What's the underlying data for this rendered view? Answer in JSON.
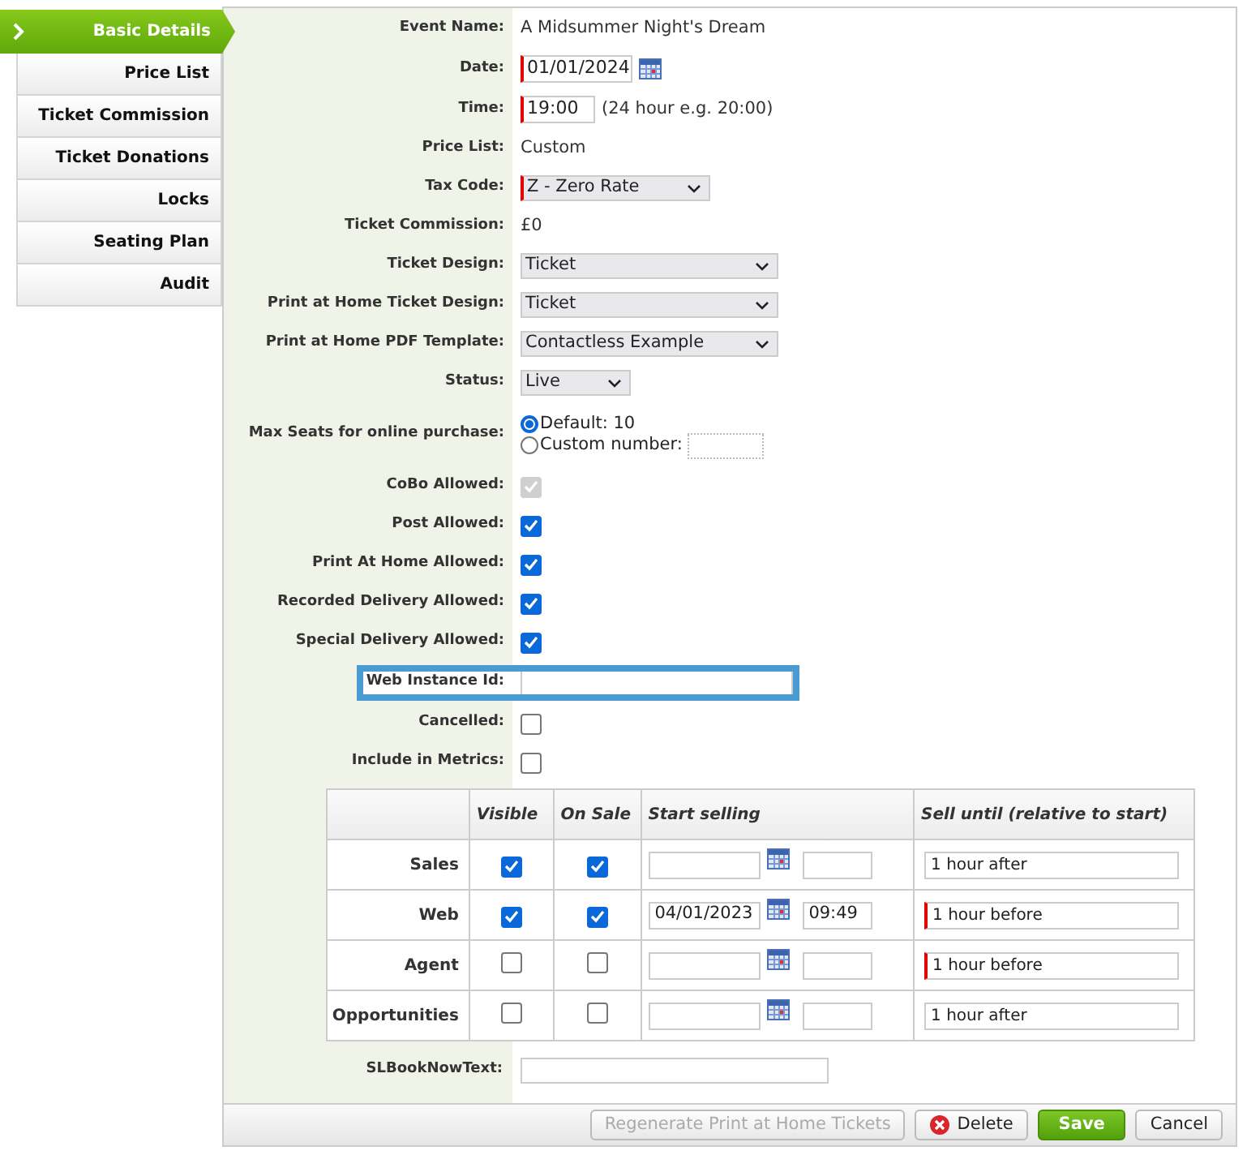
{
  "sidebar": {
    "items": [
      {
        "label": "Basic Details",
        "selected": true
      },
      {
        "label": "Price List",
        "selected": false
      },
      {
        "label": "Ticket Commission",
        "selected": false
      },
      {
        "label": "Ticket Donations",
        "selected": false
      },
      {
        "label": "Locks",
        "selected": false
      },
      {
        "label": "Seating Plan",
        "selected": false
      },
      {
        "label": "Audit",
        "selected": false
      }
    ]
  },
  "fields": [
    {
      "label": "Event Name:",
      "kind": "text",
      "value": "A Midsummer Night's Dream",
      "required": false,
      "highlighted": false
    },
    {
      "label": "Date:",
      "kind": "date",
      "value": "01/01/2024",
      "required": true,
      "highlighted": false
    },
    {
      "label": "Time:",
      "kind": "time",
      "value": "19:00",
      "hint": "(24 hour e.g. 20:00)",
      "required": true,
      "highlighted": false
    },
    {
      "label": "Price List:",
      "kind": "text",
      "value": "Custom",
      "required": false,
      "highlighted": false
    },
    {
      "label": "Tax Code:",
      "kind": "picker",
      "value": "Z - Zero Rate",
      "required": true,
      "highlighted": false
    },
    {
      "label": "Ticket Commission:",
      "kind": "text",
      "value": "£0",
      "required": false,
      "highlighted": false
    },
    {
      "label": "Ticket Design:",
      "kind": "select",
      "value": "Ticket",
      "required": false,
      "highlighted": false
    },
    {
      "label": "Print at Home Ticket Design:",
      "kind": "select",
      "value": "Ticket",
      "required": false,
      "highlighted": false
    },
    {
      "label": "Print at Home PDF Template:",
      "kind": "select",
      "value": "Contactless Example",
      "required": false,
      "highlighted": false
    },
    {
      "label": "Status:",
      "kind": "picker",
      "value": "Live",
      "required": false,
      "highlighted": false
    },
    {
      "label": "Max Seats for online purchase:",
      "kind": "radio",
      "options": [
        {
          "label": "Default: 10",
          "selected": true,
          "kind": "plain"
        },
        {
          "label": "Custom number:",
          "selected": false,
          "kind": "with_input"
        }
      ],
      "required": false,
      "highlighted": false
    },
    {
      "label": "CoBo Allowed:",
      "kind": "checkbox",
      "checked": true,
      "disabled": true,
      "required": false,
      "highlighted": false
    },
    {
      "label": "Post Allowed:",
      "kind": "checkbox",
      "checked": true,
      "disabled": false,
      "required": false,
      "highlighted": false
    },
    {
      "label": "Print At Home Allowed:",
      "kind": "checkbox",
      "checked": true,
      "disabled": false,
      "required": false,
      "highlighted": false
    },
    {
      "label": "Recorded Delivery Allowed:",
      "kind": "checkbox",
      "checked": true,
      "disabled": false,
      "required": false,
      "highlighted": false
    },
    {
      "label": "Special Delivery Allowed:",
      "kind": "checkbox",
      "checked": true,
      "disabled": false,
      "required": false,
      "highlighted": false
    },
    {
      "label": "Web Instance Id:",
      "kind": "input",
      "required": false,
      "highlighted": true
    },
    {
      "label": "Cancelled:",
      "kind": "checkbox",
      "checked": false,
      "disabled": false,
      "required": false,
      "highlighted": false
    },
    {
      "label": "Include in Metrics:",
      "kind": "checkbox",
      "checked": false,
      "disabled": false,
      "required": false,
      "highlighted": false
    }
  ],
  "sales_table": {
    "columns": [
      "Visible",
      "On Sale",
      "Start selling",
      "Sell until (relative to start)"
    ],
    "rows": [
      {
        "channel": "Sales",
        "visible": true,
        "on_sale": true,
        "sell_until": "1 hour after",
        "sell_until_required": false
      },
      {
        "channel": "Web",
        "visible": true,
        "on_sale": true,
        "start_date": "04/01/2023",
        "start_time": "09:49",
        "sell_until": "1 hour before",
        "sell_until_required": true
      },
      {
        "channel": "Agent",
        "visible": false,
        "on_sale": false,
        "sell_until": "1 hour before",
        "sell_until_required": true
      },
      {
        "channel": "Opportunities",
        "visible": false,
        "on_sale": false,
        "sell_until": "1 hour after",
        "sell_until_required": false
      }
    ]
  },
  "book_now": {
    "label": "SLBookNowText:"
  },
  "buttons": [
    {
      "label": "Regenerate Print at Home Tickets",
      "kind": "plain",
      "disabled": true
    },
    {
      "label": "Delete",
      "kind": "delete",
      "disabled": false
    },
    {
      "label": "Save",
      "kind": "primary",
      "disabled": false
    },
    {
      "label": "Cancel",
      "kind": "plain",
      "disabled": false
    }
  ]
}
